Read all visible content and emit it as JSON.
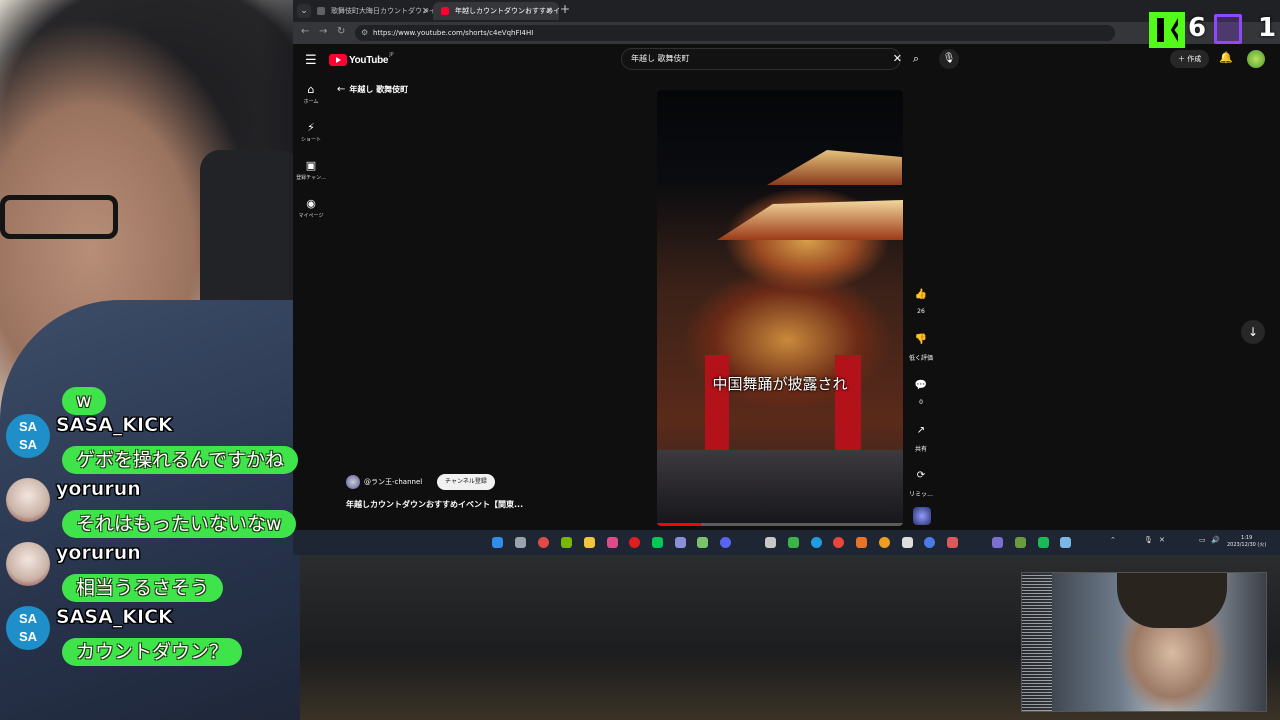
{
  "browser": {
    "tabs": [
      {
        "title": "歌舞伎町大晦日カウントダウンイベ",
        "favicon_color": "#5f6368",
        "active": false
      },
      {
        "title": "年越しカウントダウンおすすめイベ",
        "favicon_color": "#ff0033",
        "active": true
      }
    ],
    "url": "https://www.youtube.com/shorts/c4eVqhFI4HI"
  },
  "youtube": {
    "logo_text": "YouTube",
    "logo_region": "JP",
    "search_query": "年越し 歌舞伎町",
    "create_label": "作成",
    "breadcrumb": "年越し 歌舞伎町",
    "sidebar": [
      {
        "icon": "home-icon",
        "glyph": "⌂",
        "label": "ホーム"
      },
      {
        "icon": "shorts-icon",
        "glyph": "⚡",
        "label": "ショート"
      },
      {
        "icon": "subscriptions-icon",
        "glyph": "▣",
        "label": "登録チャン..."
      },
      {
        "icon": "my-page-icon",
        "glyph": "◉",
        "label": "マイページ"
      }
    ],
    "short": {
      "caption": "中国舞踊が披露され",
      "progress": 0.18,
      "channel": "@ラン王-channel",
      "subscribe_label": "チャンネル登録",
      "title": "年越しカウントダウンおすすめイベント【関東..."
    },
    "actions": [
      {
        "icon": "like-icon",
        "glyph": "👍",
        "label": "26"
      },
      {
        "icon": "dislike-icon",
        "glyph": "👎",
        "label": "低く評価"
      },
      {
        "icon": "comment-icon",
        "glyph": "💬",
        "label": "0"
      },
      {
        "icon": "share-icon",
        "glyph": "↗",
        "label": "共有"
      },
      {
        "icon": "remix-icon",
        "glyph": "⟳",
        "label": "リミッ..."
      }
    ]
  },
  "taskbar": {
    "time": "1:19",
    "date": "2023/12/30 (火)"
  },
  "overlay": {
    "kick_viewers": "6",
    "twitch_viewers": "1"
  },
  "chat": [
    {
      "user": "",
      "text": "w",
      "avatar": "none"
    },
    {
      "user": "SASA_KICK",
      "text": "ゲボを操れるんですかね",
      "avatar": "sasa"
    },
    {
      "user": "yorurun",
      "text": "それはもったいないなw",
      "avatar": "yoru"
    },
    {
      "user": "yorurun",
      "text": "相当うるさそう",
      "avatar": "yoru"
    },
    {
      "user": "SASA_KICK",
      "text": "カウントダウン？",
      "avatar": "sasa"
    }
  ],
  "colors": {
    "chat_bubble": "#3fe34a",
    "kick_green": "#53fc18",
    "twitch_purple": "#9146ff",
    "youtube_red": "#ff0033"
  }
}
